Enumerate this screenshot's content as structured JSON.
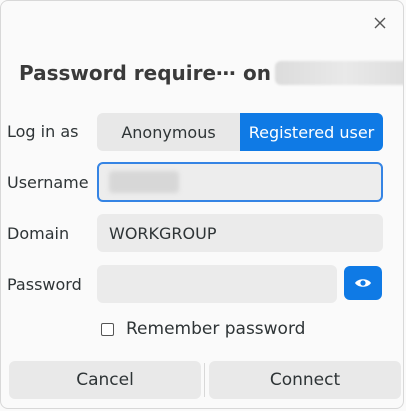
{
  "dialog": {
    "title": "Password require⋯ on",
    "close_icon": "close-icon"
  },
  "login_as": {
    "label": "Log in as",
    "options": [
      "Anonymous",
      "Registered user"
    ],
    "selected": "Registered user"
  },
  "username": {
    "label": "Username",
    "value": ""
  },
  "domain": {
    "label": "Domain",
    "value": "WORKGROUP"
  },
  "password": {
    "label": "Password",
    "value": "",
    "reveal_icon": "eye-icon"
  },
  "remember": {
    "label": "Remember password",
    "checked": false
  },
  "buttons": {
    "cancel": "Cancel",
    "connect": "Connect"
  },
  "colors": {
    "accent": "#0f7ae5",
    "focus": "#3584e4"
  }
}
